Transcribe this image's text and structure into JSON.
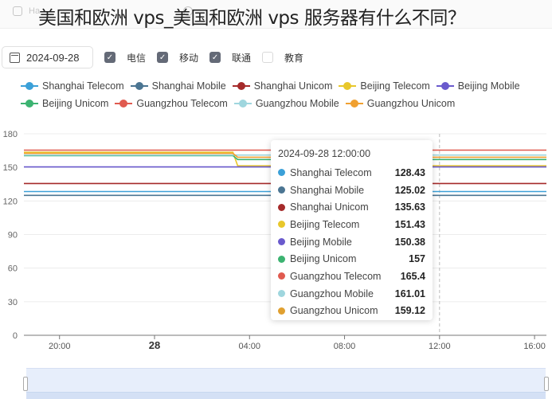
{
  "page_title": "美国和欧洲 vps_美国和欧洲 vps 服务器有什么不同？",
  "background_tabs": [
    "Ha",
    "ty",
    "",
    "s",
    "",
    "le",
    "",
    "d"
  ],
  "controls": {
    "date": "2024-09-28",
    "checkboxes": [
      {
        "label": "电信",
        "checked": true
      },
      {
        "label": "移动",
        "checked": true
      },
      {
        "label": "联通",
        "checked": true
      },
      {
        "label": "教育",
        "checked": false
      }
    ]
  },
  "chart_data": {
    "type": "line",
    "title": "",
    "xlabel": "",
    "ylabel": "",
    "ylim": [
      0,
      180
    ],
    "yticks": [
      0,
      30,
      60,
      90,
      120,
      150,
      180
    ],
    "xticks": [
      "20:00",
      "28",
      "04:00",
      "08:00",
      "12:00",
      "16:00"
    ],
    "x_range_hours": [
      -5.5,
      16.5
    ],
    "xtick_hours": [
      -4,
      0,
      4,
      8,
      12,
      16
    ],
    "grid": true,
    "legend": "top",
    "crosshair_hour": 12,
    "series": [
      {
        "name": "Shanghai Telecom",
        "color": "#3ba0d8",
        "values": [
          {
            "h": -5.5,
            "v": 128.4
          },
          {
            "h": 16.5,
            "v": 128.4
          }
        ]
      },
      {
        "name": "Shanghai Mobile",
        "color": "#4b7592",
        "values": [
          {
            "h": -5.5,
            "v": 125.0
          },
          {
            "h": 16.5,
            "v": 125.0
          }
        ]
      },
      {
        "name": "Shanghai Unicom",
        "color": "#a52a2a",
        "values": [
          {
            "h": -5.5,
            "v": 135.6
          },
          {
            "h": 16.5,
            "v": 135.6
          }
        ]
      },
      {
        "name": "Beijing Telecom",
        "color": "#e8c72b",
        "values": [
          {
            "h": -5.5,
            "v": 163.5
          },
          {
            "h": 3.3,
            "v": 163.5
          },
          {
            "h": 3.5,
            "v": 151.4
          },
          {
            "h": 16.5,
            "v": 151.4
          }
        ]
      },
      {
        "name": "Beijing Mobile",
        "color": "#6a5acd",
        "values": [
          {
            "h": -5.5,
            "v": 150.4
          },
          {
            "h": 16.5,
            "v": 150.4
          }
        ]
      },
      {
        "name": "Beijing Unicom",
        "color": "#3cb371",
        "values": [
          {
            "h": -5.5,
            "v": 160.5
          },
          {
            "h": 3.3,
            "v": 160.5
          },
          {
            "h": 3.5,
            "v": 157
          },
          {
            "h": 16.5,
            "v": 157
          }
        ]
      },
      {
        "name": "Guangzhou Telecom",
        "color": "#e05a4f",
        "values": [
          {
            "h": -5.5,
            "v": 165.4
          },
          {
            "h": 16.5,
            "v": 165.4
          }
        ]
      },
      {
        "name": "Guangzhou Mobile",
        "color": "#9fd6de",
        "values": [
          {
            "h": -5.5,
            "v": 161.0
          },
          {
            "h": 16.5,
            "v": 161.0
          }
        ]
      },
      {
        "name": "Guangzhou Unicom",
        "color": "#f0a030",
        "values": [
          {
            "h": -5.5,
            "v": 162.5
          },
          {
            "h": 3.3,
            "v": 162.5
          },
          {
            "h": 3.5,
            "v": 159.1
          },
          {
            "h": 16.5,
            "v": 159.1
          }
        ]
      }
    ]
  },
  "tooltip": {
    "title": "2024-09-28 12:00:00",
    "rows": [
      {
        "name": "Shanghai Telecom",
        "value": "128.43",
        "color": "#3ba0d8"
      },
      {
        "name": "Shanghai Mobile",
        "value": "125.02",
        "color": "#4b7592"
      },
      {
        "name": "Shanghai Unicom",
        "value": "135.63",
        "color": "#a52a2a"
      },
      {
        "name": "Beijing Telecom",
        "value": "151.43",
        "color": "#e8c72b"
      },
      {
        "name": "Beijing Mobile",
        "value": "150.38",
        "color": "#6a5acd"
      },
      {
        "name": "Beijing Unicom",
        "value": "157",
        "color": "#3cb371"
      },
      {
        "name": "Guangzhou Telecom",
        "value": "165.4",
        "color": "#e05a4f"
      },
      {
        "name": "Guangzhou Mobile",
        "value": "161.01",
        "color": "#9fd6de"
      },
      {
        "name": "Guangzhou Unicom",
        "value": "159.12",
        "color": "#e0a030"
      }
    ]
  }
}
